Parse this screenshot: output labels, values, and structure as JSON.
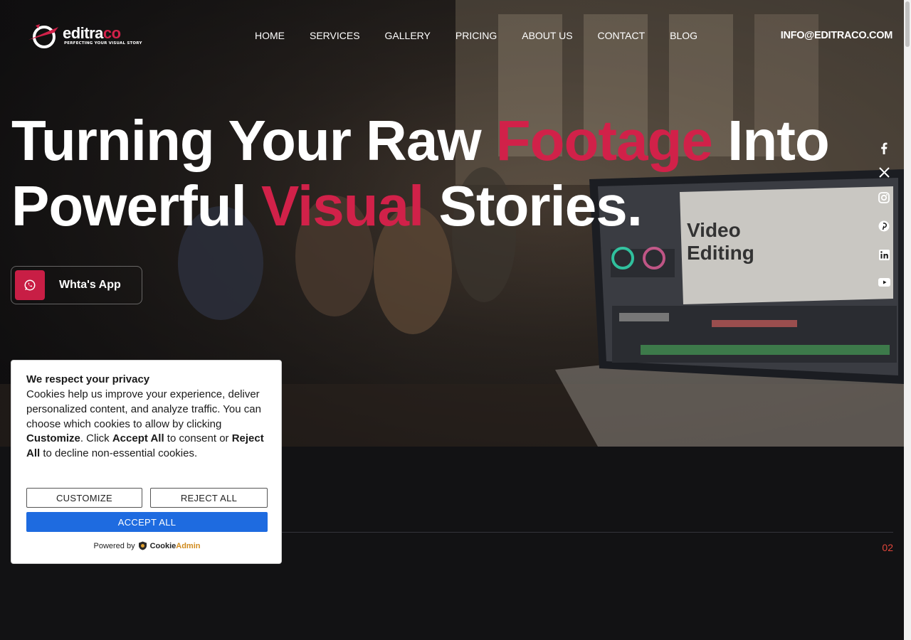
{
  "brand": {
    "logo_word_main": "editra",
    "logo_word_accent": "co",
    "tagline": "PERFECTING YOUR VISUAL STORY"
  },
  "nav": {
    "items": [
      "HOME",
      "SERVICES",
      "GALLERY",
      "PRICING",
      "ABOUT US",
      "CONTACT",
      "BLOG"
    ]
  },
  "header": {
    "email": "INFO@EDITRACO.COM"
  },
  "hero": {
    "headline_part1": "Turning Your Raw ",
    "headline_highlight1": "Footage",
    "headline_part2": " Into",
    "headline_part3": "Powerful ",
    "headline_highlight2": "Visual",
    "headline_part4": " Stories.",
    "whatsapp_label": "Whta's App",
    "monitor_text_line1": "Video",
    "monitor_text_line2": "Editing"
  },
  "social": {
    "icons": [
      "facebook-icon",
      "x-icon",
      "instagram-icon",
      "pinterest-icon",
      "linkedin-icon",
      "youtube-icon"
    ]
  },
  "slider": {
    "counter": "02"
  },
  "cookie": {
    "title": "We respect your privacy",
    "body_1": "Cookies help us improve your experience, deliver personalized content, and analyze traffic. You can choose which cookies to allow by clicking ",
    "body_customize": "Customize",
    "body_2": ". Click ",
    "body_accept": "Accept All",
    "body_3": " to consent or ",
    "body_reject": "Reject All",
    "body_4": " to decline non-essential cookies.",
    "customize_label": "CUSTOMIZE",
    "reject_label": "REJECT ALL",
    "accept_label": "ACCEPT ALL",
    "powered_by": "Powered by",
    "provider_main": "Cookie",
    "provider_accent": "Admin"
  },
  "colors": {
    "accent": "#d12149",
    "accept_button": "#1e6be0",
    "counter": "#e0453a",
    "background": "#121214"
  }
}
